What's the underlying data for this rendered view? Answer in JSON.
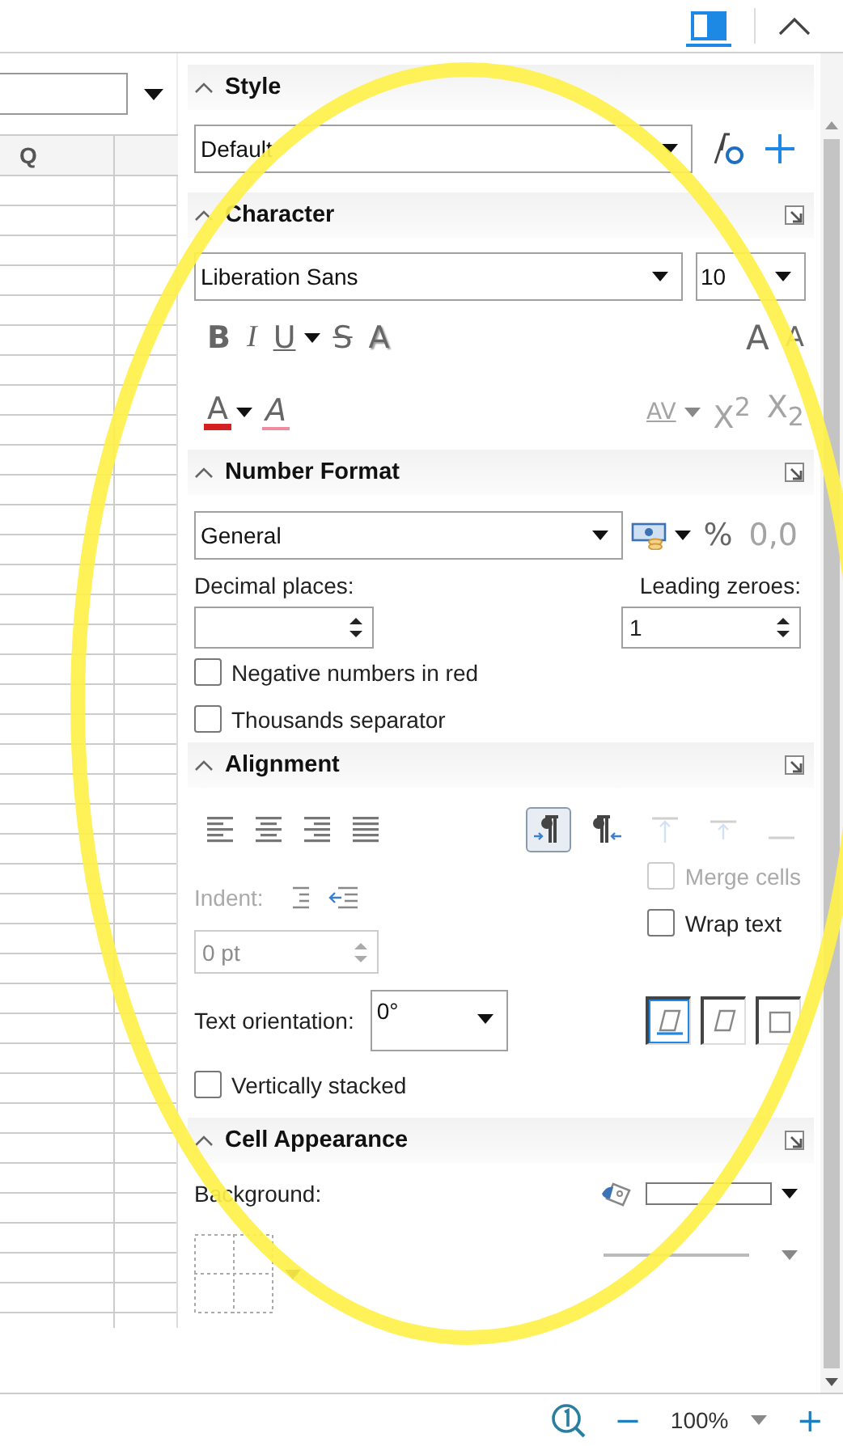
{
  "top_bar": {
    "sidebar_toggle": {
      "selected": true
    }
  },
  "sheet": {
    "column_header": "Q"
  },
  "sidebar": {
    "style": {
      "title": "Style",
      "expanded": true,
      "value": "Default"
    },
    "character": {
      "title": "Character",
      "expanded": true,
      "font_name": "Liberation Sans",
      "font_size": "10",
      "format_buttons": [
        {
          "kind": "bold",
          "label": "B",
          "dropdown": false
        },
        {
          "kind": "italic",
          "label": "I",
          "dropdown": false
        },
        {
          "kind": "underline",
          "label": "U",
          "dropdown": true
        },
        {
          "kind": "strike",
          "label": "S",
          "dropdown": false
        },
        {
          "kind": "shadow",
          "label": "A",
          "dropdown": false
        },
        {
          "kind": "grow",
          "label": "A",
          "dropdown": false
        },
        {
          "kind": "shrink",
          "label": "A",
          "dropdown": false
        }
      ],
      "color_buttons": [
        {
          "kind": "font_color",
          "label": "A",
          "color": "#d42020",
          "dropdown": true,
          "disabled": false
        },
        {
          "kind": "clear",
          "label": "A",
          "dropdown": false,
          "disabled": false
        },
        {
          "kind": "spacing",
          "label": "AV",
          "dropdown": true,
          "disabled": true
        },
        {
          "kind": "super",
          "label": "X$^{2}$",
          "dropdown": false,
          "disabled": true
        },
        {
          "kind": "sub",
          "label": "X$_{2}$",
          "dropdown": false,
          "disabled": true
        }
      ]
    },
    "number_format": {
      "title": "Number Format",
      "expanded": true,
      "format": "General",
      "tools": [
        {
          "kind": "currency",
          "dropdown": true,
          "disabled": false
        },
        {
          "kind": "percent",
          "label": "%",
          "dropdown": false,
          "disabled": false
        },
        {
          "kind": "decimal",
          "label": "0,0",
          "dropdown": false,
          "disabled": true
        }
      ],
      "decimal_places": {
        "label": "Decimal places:"
      },
      "leading_zeroes": {
        "label": "Leading zeroes:",
        "value": "1"
      },
      "options": [
        {
          "label": "Negative numbers in red",
          "checked": false
        },
        {
          "label": "Thousands separator",
          "checked": false
        }
      ]
    },
    "alignment": {
      "title": "Alignment",
      "expanded": true,
      "horizontal": [
        {
          "kind": "left",
          "selected": false
        },
        {
          "kind": "center",
          "selected": false
        },
        {
          "kind": "right",
          "selected": false
        },
        {
          "kind": "justify",
          "selected": false
        }
      ],
      "flow": [
        {
          "kind": "indent_wrap",
          "selected": true,
          "disabled": false
        },
        {
          "kind": "shrink_wrap",
          "selected": false,
          "disabled": false
        },
        {
          "kind": "top",
          "selected": false,
          "disabled": true
        },
        {
          "kind": "middle",
          "selected": false,
          "disabled": true
        },
        {
          "kind": "bottom",
          "selected": false,
          "disabled": true
        }
      ],
      "indent": {
        "label": "Indent:",
        "value": "0 pt",
        "disabled": true
      },
      "cell_options": [
        {
          "label": "Merge cells",
          "checked": false,
          "disabled": true
        },
        {
          "label": "Wrap text",
          "checked": false,
          "disabled": false
        }
      ],
      "orientation": {
        "label": "Text orientation:",
        "value": "0°"
      },
      "orientation_modes": [
        {
          "kind": "bottom_edge",
          "selected": true
        },
        {
          "kind": "top_edge",
          "selected": false
        },
        {
          "kind": "inside",
          "selected": false
        }
      ],
      "vertically_stacked": {
        "label": "Vertically stacked",
        "checked": false
      }
    },
    "cell_appearance": {
      "title": "Cell Appearance",
      "expanded": true,
      "background_label": "Background:"
    }
  },
  "status_bar": {
    "zoom_out": "−",
    "zoom": "100%",
    "zoom_in": "+"
  },
  "annotation": {
    "kind": "ellipse"
  }
}
